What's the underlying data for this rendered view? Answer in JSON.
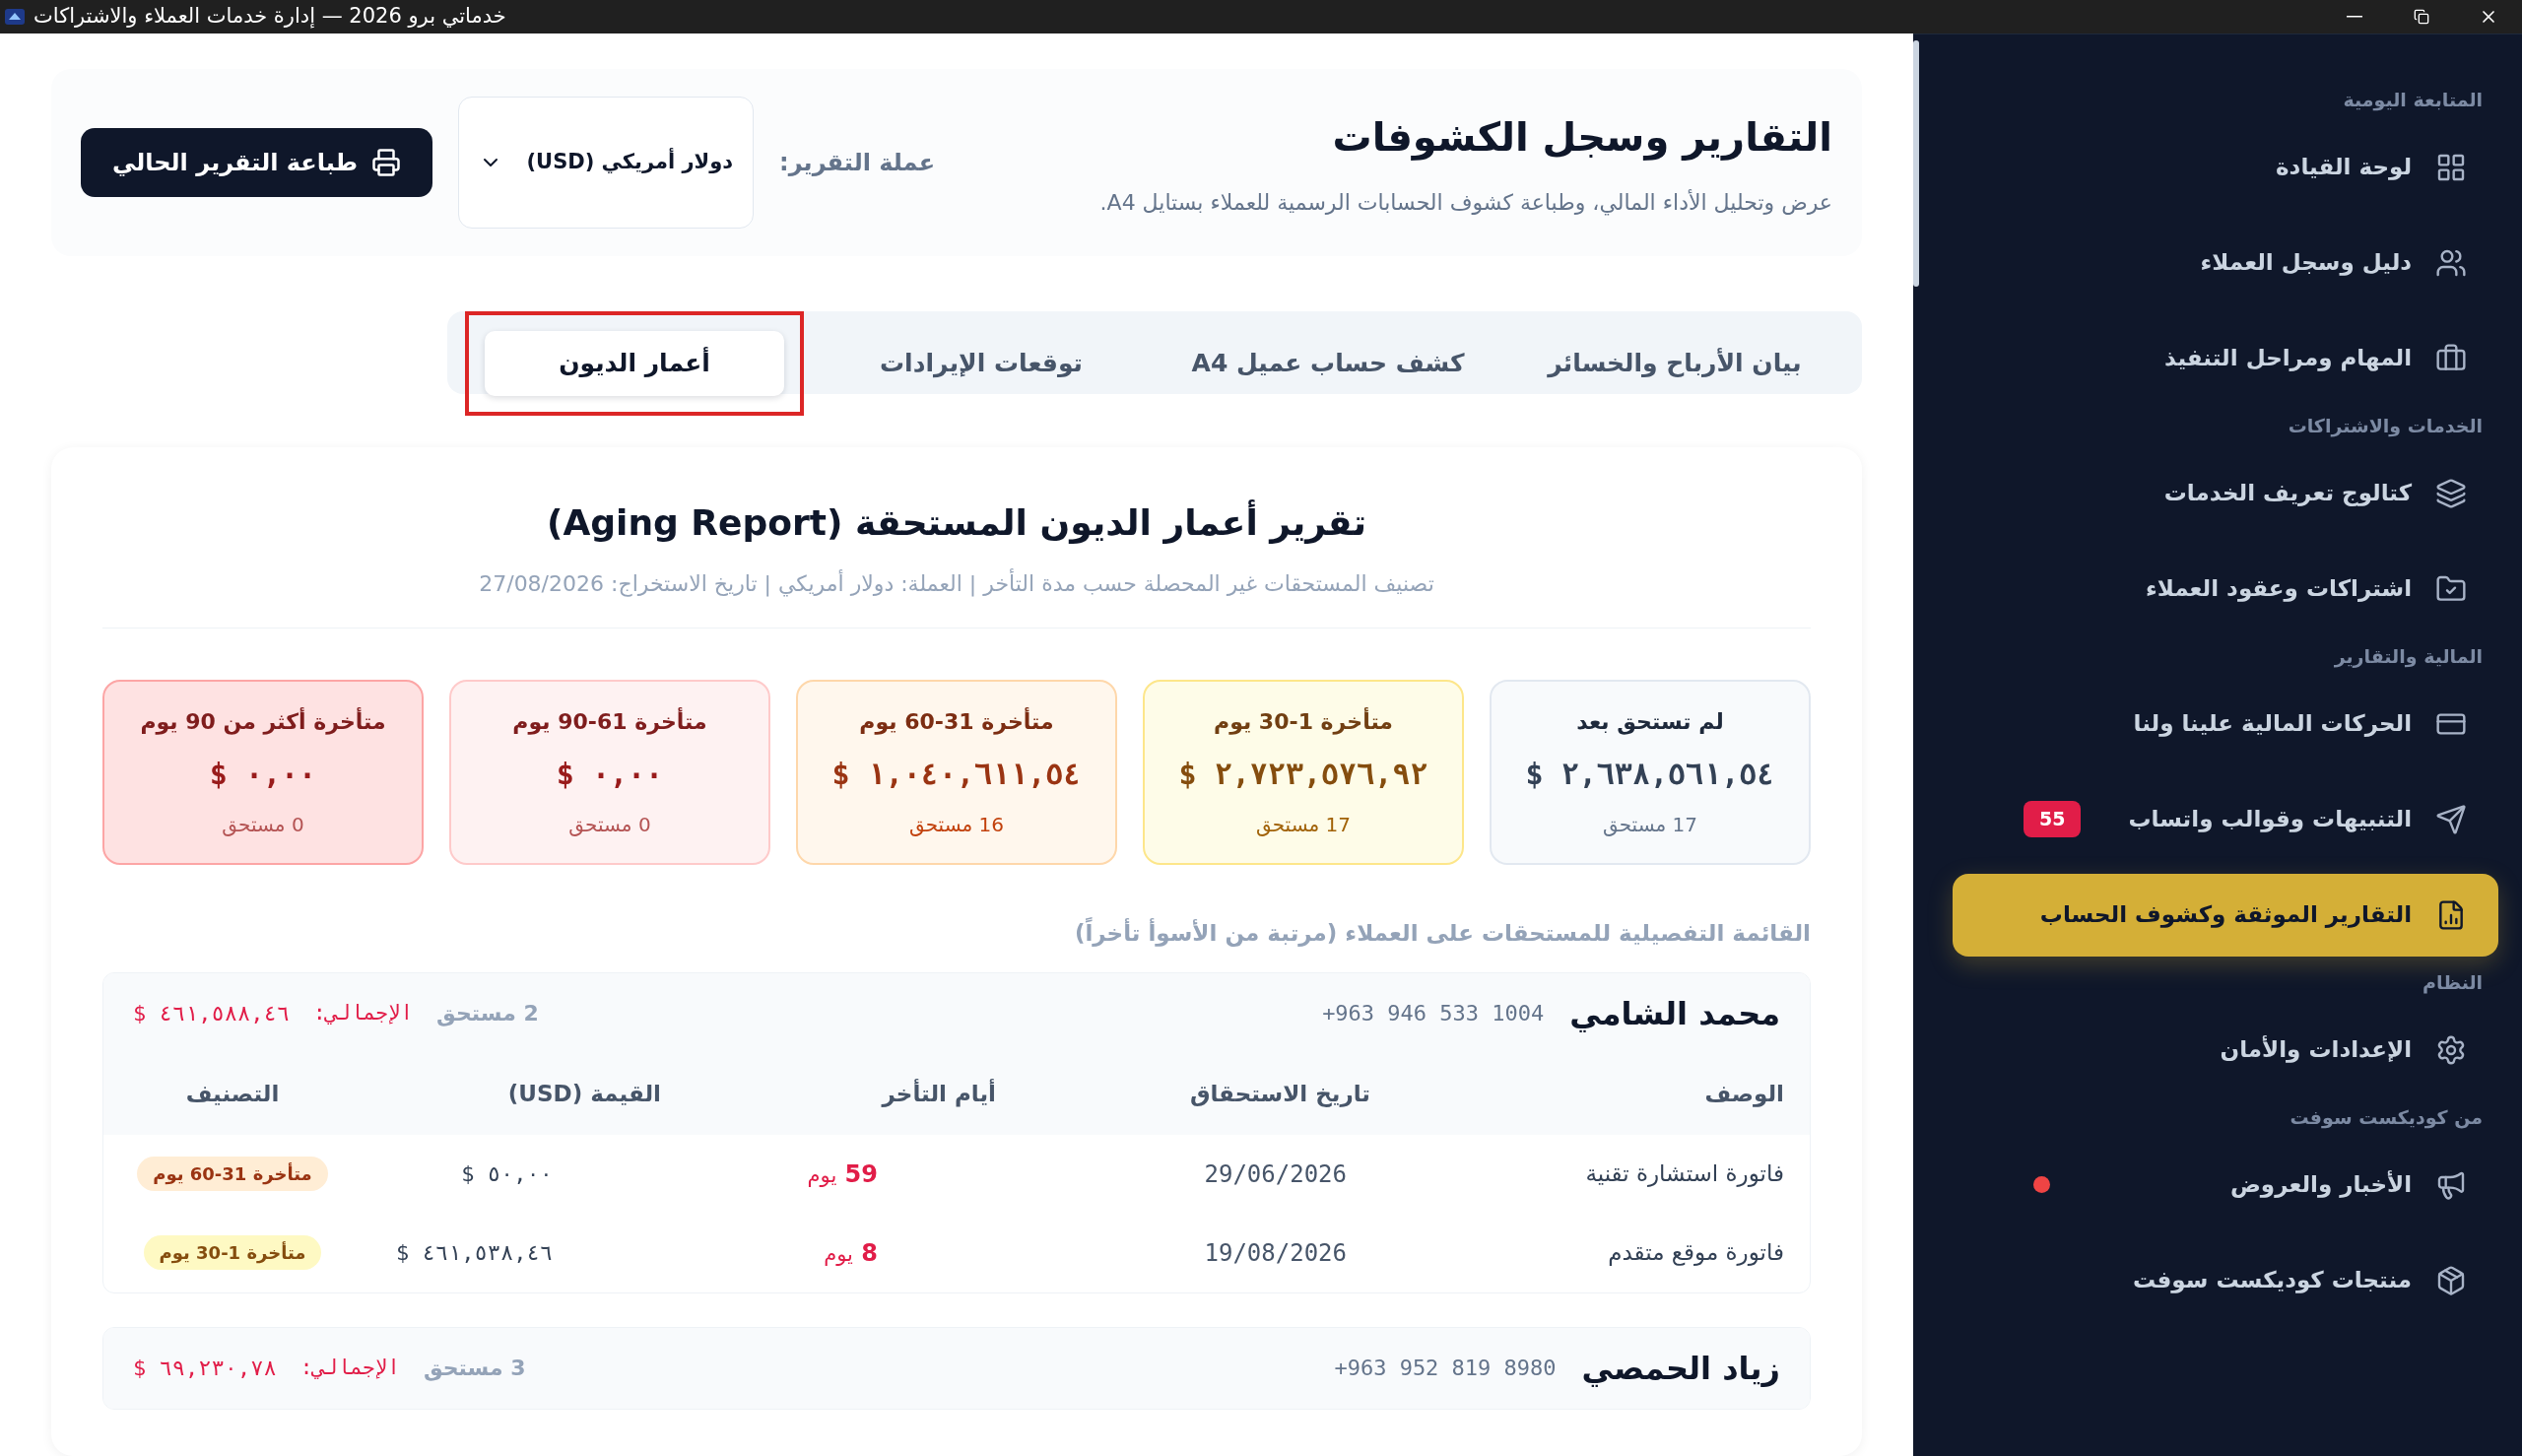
{
  "window": {
    "title": "خدماتي برو 2026 — إدارة خدمات العملاء والاشتراكات"
  },
  "sidebar": {
    "sections": [
      {
        "heading": "المتابعة اليومية",
        "items": [
          {
            "label": "لوحة القيادة",
            "selected": false
          },
          {
            "label": "دليل وسجل العملاء",
            "selected": false
          },
          {
            "label": "المهام ومراحل التنفيذ",
            "selected": false
          }
        ]
      },
      {
        "heading": "الخدمات والاشتراكات",
        "items": [
          {
            "label": "كتالوج تعريف الخدمات",
            "selected": false
          },
          {
            "label": "اشتراكات وعقود العملاء",
            "selected": false
          }
        ]
      },
      {
        "heading": "المالية والتقارير",
        "items": [
          {
            "label": "الحركات المالية علينا ولنا",
            "selected": false
          },
          {
            "label": "التنبيهات وقوالب واتساب",
            "selected": false,
            "badge": "55"
          },
          {
            "label": "التقارير الموثقة وكشوف الحساب",
            "selected": true
          }
        ]
      },
      {
        "heading": "النظام",
        "items": [
          {
            "label": "الإعدادات والأمان",
            "selected": false
          }
        ]
      },
      {
        "heading": "من كوديكست سوفت",
        "items": [
          {
            "label": "الأخبار والعروض",
            "selected": false,
            "unread": true
          },
          {
            "label": "منتجات كوديكست سوفت",
            "selected": false
          }
        ]
      }
    ]
  },
  "header": {
    "title": "التقارير وسجل الكشوفات",
    "subtitle": "عرض وتحليل الأداء المالي، وطباعة كشوف الحسابات الرسمية للعملاء بستايل A4.",
    "currency_label": "عملة التقرير:",
    "currency_select": {
      "value": "دولار أمريكي (USD)"
    },
    "print_button": "طباعة التقرير الحالي"
  },
  "tabs": [
    {
      "label": "بيان الأرباح والخسائر",
      "selected": false,
      "highlighted": false
    },
    {
      "label": "كشف حساب عميل A4",
      "selected": false,
      "highlighted": false
    },
    {
      "label": "توقعات الإيرادات",
      "selected": false,
      "highlighted": false
    },
    {
      "label": "أعمار الديون",
      "selected": true,
      "highlighted": true
    }
  ],
  "report": {
    "title": "تقرير أعمار الديون المستحقة (Aging Report)",
    "subtitle": "تصنيف المستحقات غير المحصلة حسب مدة التأخر | العملة: دولار أمريكي | تاريخ الاستخراج: 27/08/2026",
    "summary_cards": [
      {
        "kind": "neutral",
        "label": "لم تستحق بعد",
        "amount": "$ ٢,٦٣٨,٥٦١,٥٤",
        "count": "17 مستحق"
      },
      {
        "kind": "yellow",
        "label": "متأخرة 1-30 يوم",
        "amount": "$ ٢,٧٢٣,٥٧٦,٩٢",
        "count": "17 مستحق"
      },
      {
        "kind": "orange",
        "label": "متأخرة 31-60 يوم",
        "amount": "$ ١,٠٤٠,٦١١,٥٤",
        "count": "16 مستحق"
      },
      {
        "kind": "rose",
        "label": "متأخرة 61-90 يوم",
        "amount": "$ ٠,٠٠",
        "count": "0 مستحق"
      },
      {
        "kind": "red",
        "label": "متأخرة أكثر من 90 يوم",
        "amount": "$ ٠,٠٠",
        "count": "0 مستحق"
      }
    ],
    "list_title": "القائمة التفصيلية للمستحقات على العملاء (مرتبة من الأسوأ تأخراً)",
    "customers": [
      {
        "name": "محمد الشامي",
        "phone": "+963 946 533 1004",
        "count": "2 مستحق",
        "total_label": "الإجمالي:",
        "total": "$ ٤٦١,٥٨٨,٤٦",
        "columns": [
          "الوصف",
          "تاريخ الاستحقاق",
          "أيام التأخر",
          "القيمة (USD)",
          "التصنيف"
        ],
        "rows": [
          {
            "description": "فاتورة استشارة تقنية",
            "due_date": "29/06/2026",
            "days_late": "59",
            "days_unit": "يوم",
            "amount": "$ ٥٠,٠٠",
            "category": {
              "label": "متأخرة 31-60 يوم",
              "kind": "orange"
            }
          },
          {
            "description": "فاتورة موقع متقدم",
            "due_date": "19/08/2026",
            "days_late": "8",
            "days_unit": "يوم",
            "amount": "$ ٤٦١,٥٣٨,٤٦",
            "category": {
              "label": "متأخرة 1-30 يوم",
              "kind": "yellow"
            }
          }
        ]
      },
      {
        "name": "زياد الحمصي",
        "phone": "+963 952 819 8980",
        "count": "3 مستحق",
        "total_label": "الإجمالي:",
        "total": "$ ٦٩,٢٣٠,٧٨"
      }
    ]
  }
}
